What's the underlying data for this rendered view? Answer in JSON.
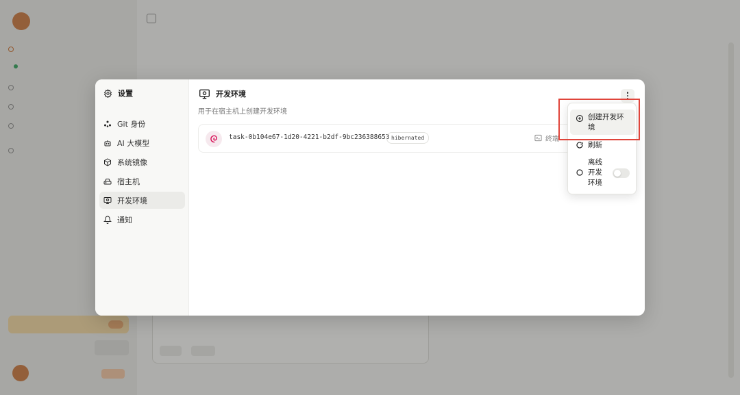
{
  "modal": {
    "title": "设置",
    "nav": [
      {
        "label": "Git 身份",
        "icon": "git-identity-icon"
      },
      {
        "label": "AI 大模型",
        "icon": "robot-icon"
      },
      {
        "label": "系统镜像",
        "icon": "box-icon"
      },
      {
        "label": "宿主机",
        "icon": "host-drive-icon"
      },
      {
        "label": "开发环境",
        "icon": "monitor-icon",
        "active": true
      },
      {
        "label": "通知",
        "icon": "bell-icon"
      }
    ]
  },
  "content": {
    "title": "开发环境",
    "subtitle": "用于在宿主机上创建开发环境",
    "env": {
      "name": "task-0b104e67-1d20-4221-b2df-9bc236388653",
      "status": "hibernated",
      "terminal_label": "终端"
    }
  },
  "dropdown": {
    "create_line1": "创建开发环",
    "create_line2": "境",
    "refresh": "刷新",
    "offline_line1": "离线",
    "offline_line2": "开发",
    "offline_line3": "环境",
    "offline_toggle_on": false
  },
  "colors": {
    "highlight_border": "#e0443a",
    "debian_red": "#d70a53",
    "active_nav_bg": "#ebebe8"
  }
}
